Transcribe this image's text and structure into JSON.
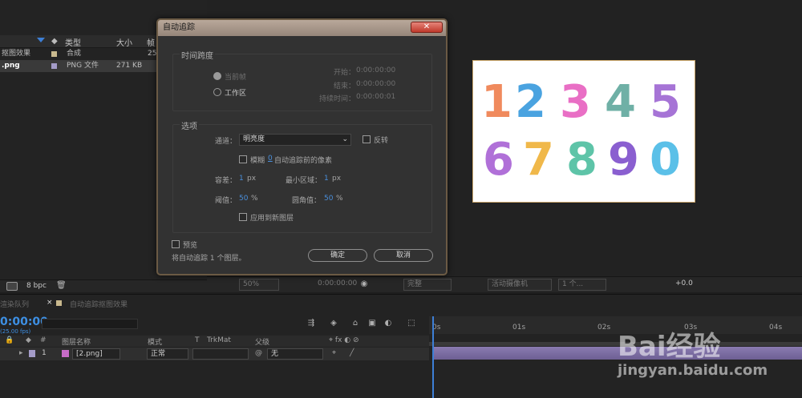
{
  "project": {
    "columns": {
      "type": "类型",
      "size": "大小",
      "fr": "帧"
    },
    "items": [
      {
        "name": "抠图效果",
        "type": "合成",
        "size": "",
        "fr": "25"
      },
      {
        "name": ".png",
        "type": "PNG 文件",
        "size": "271 KB",
        "fr": ""
      }
    ],
    "bpc": "8 bpc"
  },
  "viewer": {
    "zoom": "50%",
    "timecode": "0:00:00:00",
    "quality": "完整",
    "camera": "活动摄像机",
    "views": "1 个...",
    "exposure": "+0.0"
  },
  "composition_digits": [
    "1",
    "2",
    "3",
    "4",
    "5",
    "6",
    "7",
    "8",
    "9",
    "0"
  ],
  "dialog": {
    "title": "自动追踪",
    "close_icon": "close-icon",
    "time_span": {
      "label": "时间跨度",
      "current_frame": "当前帧",
      "work_area": "工作区",
      "start_label": "开始：",
      "start": "0:00:00:00",
      "end_label": "结束：",
      "end": "0:00:00:00",
      "duration_label": "持续时间：",
      "duration": "0:00:00:01"
    },
    "options": {
      "label": "选项",
      "channel_label": "通道：",
      "channel_value": "明亮度",
      "invert": "反转",
      "blur_label": "模糊",
      "blur_value": "0",
      "blur_suffix": "自动追踪前的像素",
      "tolerance_label": "容差：",
      "tolerance_value": "1",
      "tolerance_unit": "px",
      "min_area_label": "最小区域：",
      "min_area_value": "1",
      "min_area_unit": "px",
      "threshold_label": "阈值：",
      "threshold_value": "50",
      "threshold_unit": "%",
      "corner_label": "圆角值：",
      "corner_value": "50",
      "corner_unit": "%",
      "apply_new_layer": "应用到新图层"
    },
    "preview": "预览",
    "status": "将自动追踪 1 个图层。",
    "ok": "确定",
    "cancel": "取消"
  },
  "timeline": {
    "tabs": [
      {
        "label": "渲染队列"
      },
      {
        "label": "自动追踪抠图效果"
      }
    ],
    "timecode": "0:00:00",
    "fps": "(25.00 fps)",
    "columns": {
      "num": "#",
      "layer_name": "图层名称",
      "mode": "模式",
      "t": "T",
      "trkmat": "TrkMat",
      "parent": "父级"
    },
    "layer": {
      "num": "1",
      "name": "[2.png]",
      "mode": "正常",
      "parent": "无"
    },
    "ruler": [
      "0s",
      "01s",
      "02s",
      "03s",
      "04s"
    ]
  },
  "watermark": {
    "brand": "Bai经验",
    "url": "jingyan.baidu.com"
  },
  "colors": {
    "accent": "#4a8fdc",
    "layer_bar": "#7a6ca3",
    "playhead": "#3d7fd6"
  }
}
